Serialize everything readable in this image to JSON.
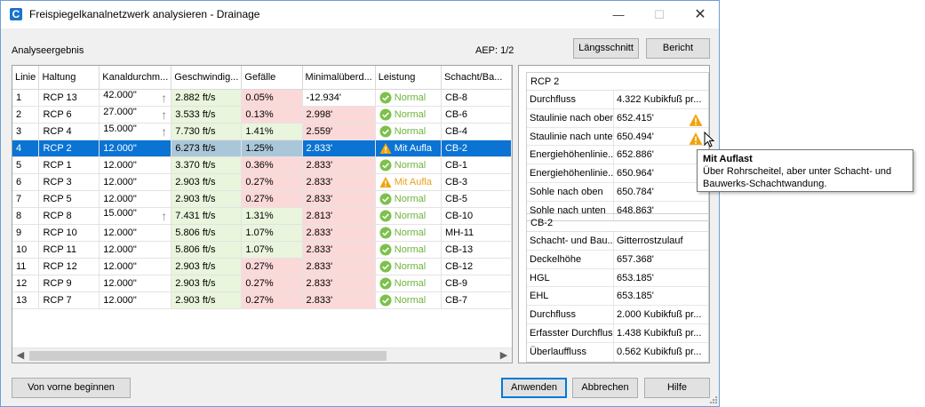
{
  "window": {
    "title": "Freispiegelkanalnetzwerk analysieren - Drainage",
    "app_icon_letter": "C",
    "minimize_icon": "minimize-icon",
    "maximize_icon": "maximize-icon",
    "close_icon": "close-icon"
  },
  "header": {
    "analysis_label": "Analyseergebnis",
    "aep": "AEP: 1/2",
    "buttons": {
      "laengsschnitt": "Längsschnitt",
      "bericht": "Bericht"
    }
  },
  "colors": {
    "selected_row": "#0a73d4",
    "ok_green": "#6cb43c",
    "warn_orange": "#e8a21a",
    "cell_green": "#e9f5dc",
    "cell_red": "#fcd9d9"
  },
  "table": {
    "columns": [
      "Linie",
      "Haltung",
      "Kanaldurchm...",
      "Geschwindig...",
      "Gefälle",
      "Minimalüberd...",
      "Leistung",
      "Schacht/Ba..."
    ],
    "rows": [
      {
        "linie": "1",
        "haltung": "RCP 13",
        "durchm": "42.000\"",
        "arrow": true,
        "geschw": "2.882 ft/s",
        "gefaelle": "0.05%",
        "gef_status": "red",
        "minimal": "-12.934'",
        "min_status": "none",
        "leistung": "Normal",
        "leistung_status": "ok",
        "schacht": "CB-8"
      },
      {
        "linie": "2",
        "haltung": "RCP 6",
        "durchm": "27.000\"",
        "arrow": true,
        "geschw": "3.533 ft/s",
        "gefaelle": "0.13%",
        "gef_status": "red",
        "minimal": "2.998'",
        "min_status": "red",
        "leistung": "Normal",
        "leistung_status": "ok",
        "schacht": "CB-6"
      },
      {
        "linie": "3",
        "haltung": "RCP 4",
        "durchm": "15.000\"",
        "arrow": true,
        "geschw": "7.730 ft/s",
        "gefaelle": "1.41%",
        "gef_status": "green",
        "minimal": "2.559'",
        "min_status": "red",
        "leistung": "Normal",
        "leistung_status": "ok",
        "schacht": "CB-4"
      },
      {
        "linie": "4",
        "haltung": "RCP 2",
        "durchm": "12.000\"",
        "arrow": false,
        "geschw": "6.273 ft/s",
        "gefaelle": "1.25%",
        "gef_status": "green",
        "minimal": "2.833'",
        "min_status": "red",
        "leistung": "Mit Aufla",
        "leistung_status": "warn",
        "schacht": "CB-2",
        "selected": true
      },
      {
        "linie": "5",
        "haltung": "RCP 1",
        "durchm": "12.000\"",
        "arrow": false,
        "geschw": "3.370 ft/s",
        "gefaelle": "0.36%",
        "gef_status": "red",
        "minimal": "2.833'",
        "min_status": "red",
        "leistung": "Normal",
        "leistung_status": "ok",
        "schacht": "CB-1"
      },
      {
        "linie": "6",
        "haltung": "RCP 3",
        "durchm": "12.000\"",
        "arrow": false,
        "geschw": "2.903 ft/s",
        "gefaelle": "0.27%",
        "gef_status": "red",
        "minimal": "2.833'",
        "min_status": "red",
        "leistung": "Mit Aufla",
        "leistung_status": "warn",
        "schacht": "CB-3"
      },
      {
        "linie": "7",
        "haltung": "RCP 5",
        "durchm": "12.000\"",
        "arrow": false,
        "geschw": "2.903 ft/s",
        "gefaelle": "0.27%",
        "gef_status": "red",
        "minimal": "2.833'",
        "min_status": "red",
        "leistung": "Normal",
        "leistung_status": "ok",
        "schacht": "CB-5"
      },
      {
        "linie": "8",
        "haltung": "RCP 8",
        "durchm": "15.000\"",
        "arrow": true,
        "geschw": "7.431 ft/s",
        "gefaelle": "1.31%",
        "gef_status": "green",
        "minimal": "2.813'",
        "min_status": "red",
        "leistung": "Normal",
        "leistung_status": "ok",
        "schacht": "CB-10"
      },
      {
        "linie": "9",
        "haltung": "RCP 10",
        "durchm": "12.000\"",
        "arrow": false,
        "geschw": "5.806 ft/s",
        "gefaelle": "1.07%",
        "gef_status": "green",
        "minimal": "2.833'",
        "min_status": "red",
        "leistung": "Normal",
        "leistung_status": "ok",
        "schacht": "MH-11"
      },
      {
        "linie": "10",
        "haltung": "RCP 11",
        "durchm": "12.000\"",
        "arrow": false,
        "geschw": "5.806 ft/s",
        "gefaelle": "1.07%",
        "gef_status": "green",
        "minimal": "2.833'",
        "min_status": "red",
        "leistung": "Normal",
        "leistung_status": "ok",
        "schacht": "CB-13"
      },
      {
        "linie": "11",
        "haltung": "RCP 12",
        "durchm": "12.000\"",
        "arrow": false,
        "geschw": "2.903 ft/s",
        "gefaelle": "0.27%",
        "gef_status": "red",
        "minimal": "2.833'",
        "min_status": "red",
        "leistung": "Normal",
        "leistung_status": "ok",
        "schacht": "CB-12"
      },
      {
        "linie": "12",
        "haltung": "RCP 9",
        "durchm": "12.000\"",
        "arrow": false,
        "geschw": "2.903 ft/s",
        "gefaelle": "0.27%",
        "gef_status": "red",
        "minimal": "2.833'",
        "min_status": "red",
        "leistung": "Normal",
        "leistung_status": "ok",
        "schacht": "CB-9"
      },
      {
        "linie": "13",
        "haltung": "RCP 7",
        "durchm": "12.000\"",
        "arrow": false,
        "geschw": "2.903 ft/s",
        "gefaelle": "0.27%",
        "gef_status": "red",
        "minimal": "2.833'",
        "min_status": "red",
        "leistung": "Normal",
        "leistung_status": "ok",
        "schacht": "CB-7"
      }
    ],
    "scroll_left_icon": "scroll-left-icon",
    "scroll_right_icon": "scroll-right-icon"
  },
  "pipe_props": {
    "title": "RCP 2",
    "rows": [
      {
        "key": "Durchfluss",
        "value": "4.322 Kubikfuß pr...",
        "warn": false
      },
      {
        "key": "Staulinie nach oben",
        "value": "652.415'",
        "warn": true
      },
      {
        "key": "Staulinie nach unten",
        "value": "650.494'",
        "warn": true
      },
      {
        "key": "Energiehöhenlinie...",
        "value": "652.886'",
        "warn": false
      },
      {
        "key": "Energiehöhenlinie...",
        "value": "650.964'",
        "warn": false
      },
      {
        "key": "Sohle nach oben",
        "value": "650.784'",
        "warn": false
      },
      {
        "key": "Sohle nach unten",
        "value": "648.863'",
        "warn": false
      }
    ]
  },
  "structure_props": {
    "title": "CB-2",
    "rows": [
      {
        "key": "Schacht- und Bau...",
        "value": "Gitterrostzulauf"
      },
      {
        "key": "Deckelhöhe",
        "value": "657.368'"
      },
      {
        "key": "HGL",
        "value": "653.185'"
      },
      {
        "key": "EHL",
        "value": "653.185'"
      },
      {
        "key": "Durchfluss",
        "value": "2.000 Kubikfuß pr..."
      },
      {
        "key": "Erfasster Durchfluss",
        "value": "1.438 Kubikfuß pr..."
      },
      {
        "key": "Überlauffluss",
        "value": "0.562 Kubikfuß pr..."
      }
    ]
  },
  "tooltip": {
    "title": "Mit Auflast",
    "text": "Über Rohrscheitel, aber unter Schacht- und Bauwerks-Schachtwandung."
  },
  "footer": {
    "restart": "Von vorne beginnen",
    "apply": "Anwenden",
    "cancel": "Abbrechen",
    "help": "Hilfe"
  }
}
